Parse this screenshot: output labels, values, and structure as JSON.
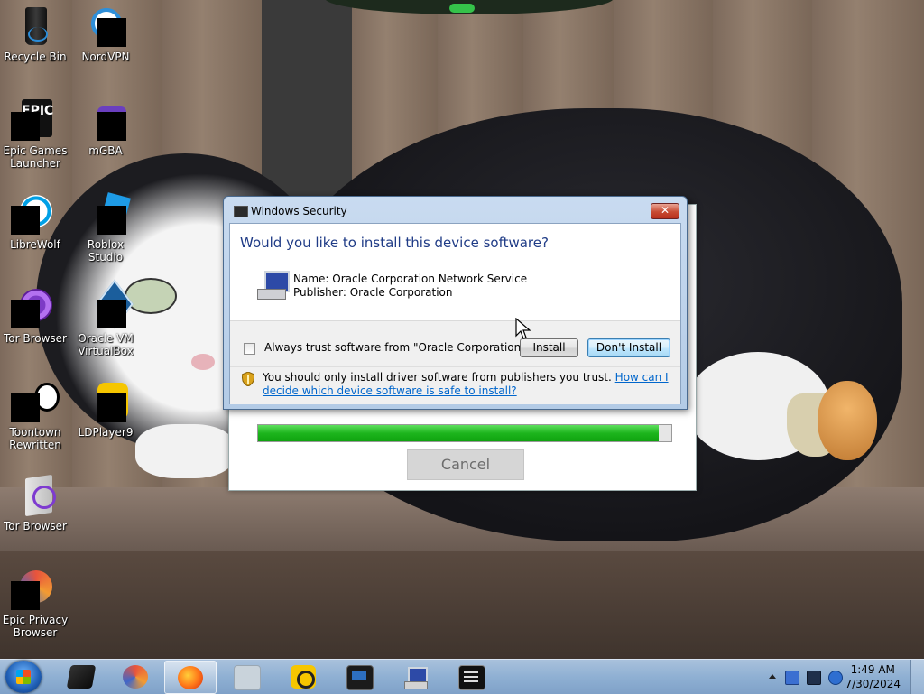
{
  "desktop": {
    "icons": [
      {
        "label": "Recycle Bin"
      },
      {
        "label": "NordVPN"
      },
      {
        "label": "Epic Games Launcher"
      },
      {
        "label": "mGBA"
      },
      {
        "label": "LibreWolf"
      },
      {
        "label": "Roblox Studio"
      },
      {
        "label": "Tor Browser"
      },
      {
        "label": "Oracle VM VirtualBox"
      },
      {
        "label": "Toontown Rewritten"
      },
      {
        "label": "LDPlayer9"
      },
      {
        "label": "Tor Browser"
      },
      {
        "label": "Epic Privacy Browser"
      }
    ],
    "epic_logo_text": "EPIC"
  },
  "installer": {
    "progress_percent": 97,
    "cancel_label": "Cancel"
  },
  "dialog": {
    "title": "Windows Security",
    "close_glyph": "✕",
    "question": "Would you like to install this device software?",
    "name_line": "Name: Oracle Corporation Network Service",
    "publisher_line": "Publisher: Oracle Corporation",
    "always_trust_label": "Always trust software from \"Oracle Corporation\".",
    "always_trust_checked": false,
    "install_label": "Install",
    "dont_install_label": "Don't Install",
    "warning_text": "You should only install driver software from publishers you trust.",
    "warning_link": "How can I decide which device software is safe to install?"
  },
  "taskbar": {
    "apps": [
      "start",
      "virtualbox-manager",
      "epic-privacy-browser",
      "firefox",
      "roblox",
      "ldplayer",
      "oracle-vm",
      "installer",
      "console"
    ],
    "active_app": "firefox",
    "clock_time": "1:49 AM",
    "clock_date": "7/30/2024",
    "tray_icons": [
      "show-hidden-icons",
      "network-icon",
      "monitor-icon",
      "volume-icon"
    ]
  },
  "colors": {
    "dialog_title_blue": "#1f3b86",
    "link_blue": "#0066cc",
    "progress_green": "#1db51d"
  }
}
